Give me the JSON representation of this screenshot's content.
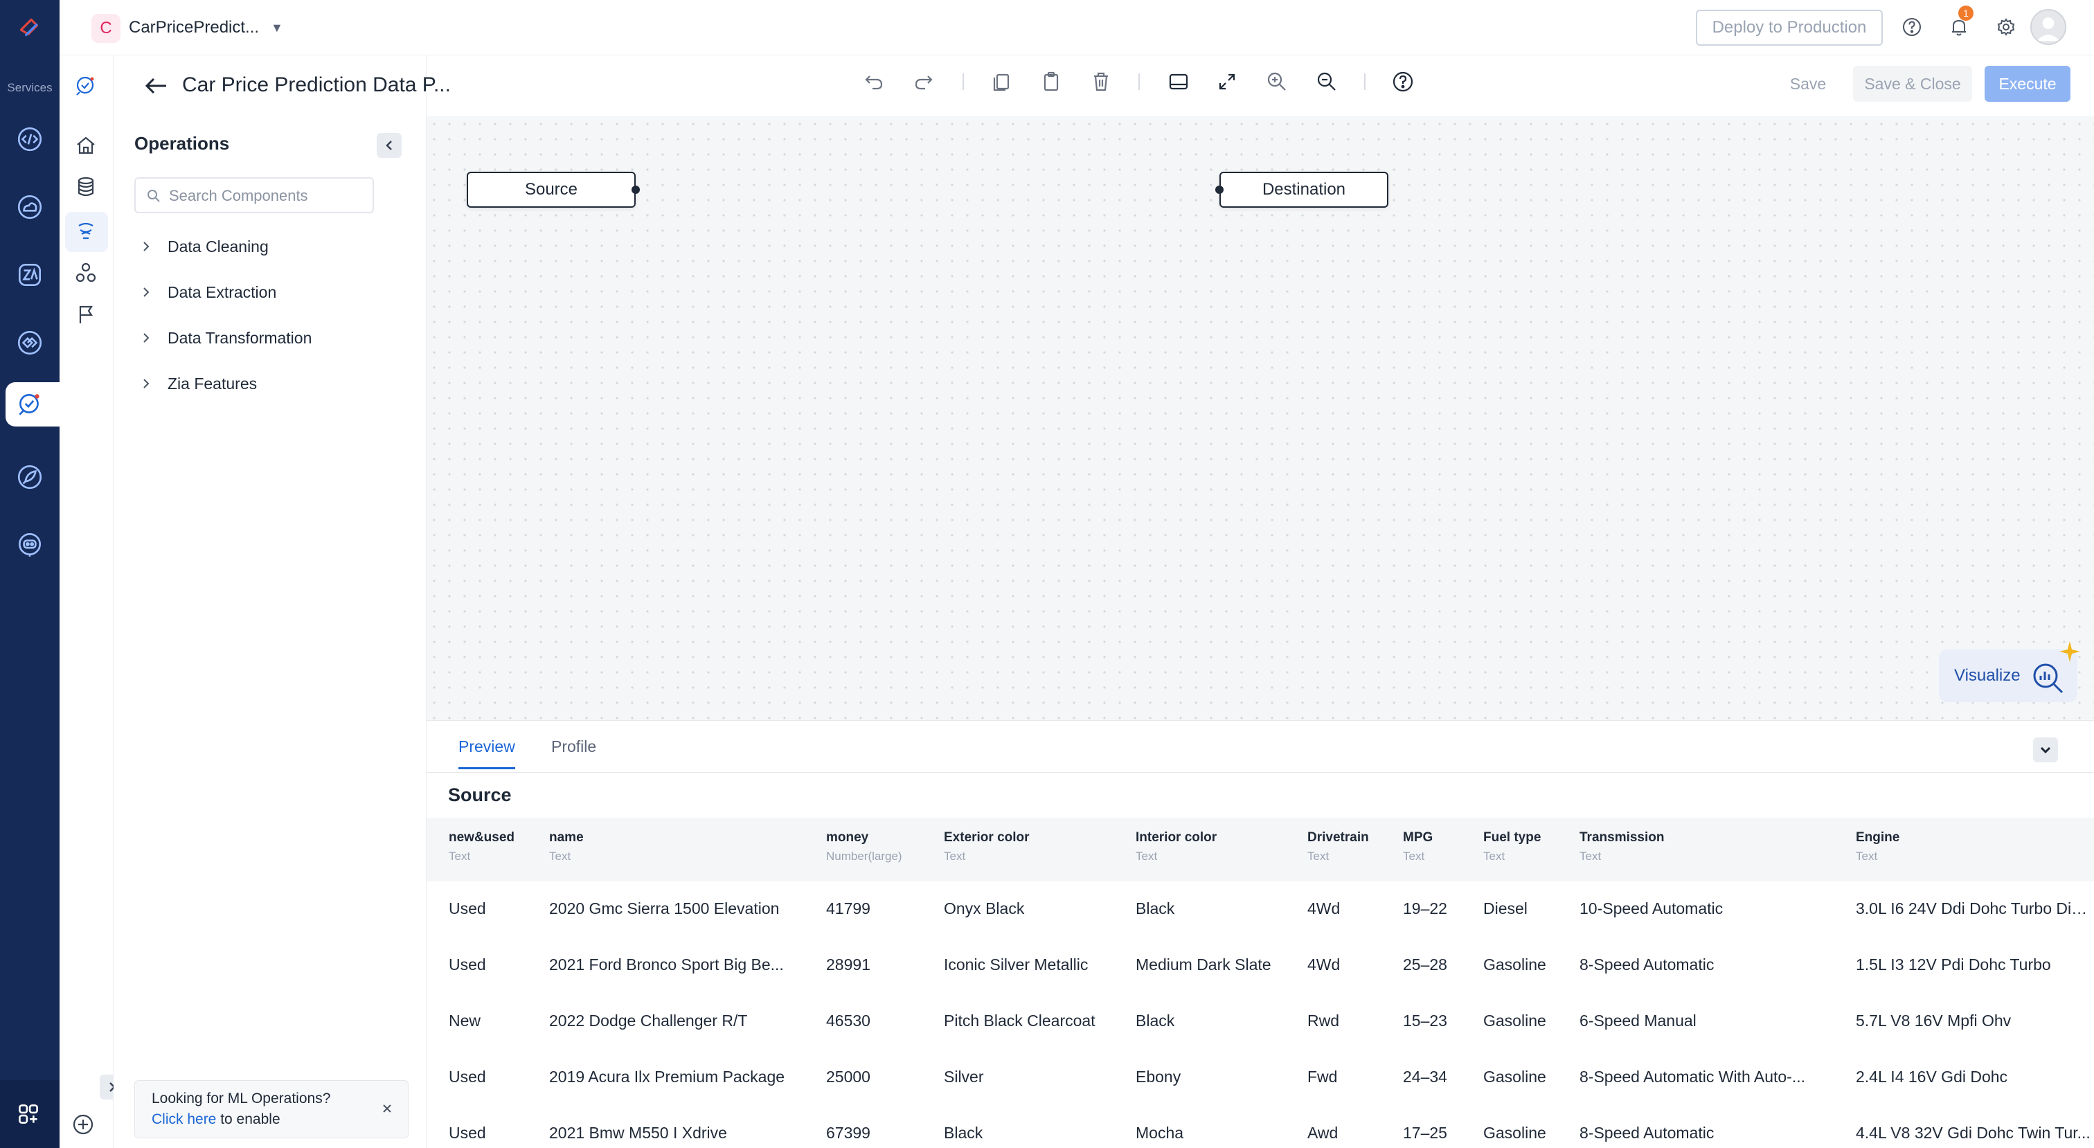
{
  "rail": {
    "services_label": "Services"
  },
  "header": {
    "project_initial": "C",
    "project_name": "CarPricePredict...",
    "deploy_label": "Deploy to Production",
    "notification_count": "1"
  },
  "page": {
    "title": "Car Price Prediction Data P..."
  },
  "toolbar": {
    "save_label": "Save",
    "save_close_label": "Save & Close",
    "execute_label": "Execute"
  },
  "operations": {
    "title": "Operations",
    "search_placeholder": "Search Components",
    "items": [
      {
        "label": "Data Cleaning"
      },
      {
        "label": "Data Extraction"
      },
      {
        "label": "Data Transformation"
      },
      {
        "label": "Zia Features"
      }
    ],
    "mlops_prompt": "Looking for ML Operations?",
    "mlops_link": "Click here",
    "mlops_suffix": " to enable"
  },
  "canvas": {
    "nodes": [
      {
        "label": "Source"
      },
      {
        "label": "Destination"
      }
    ],
    "visualize_label": "Visualize"
  },
  "preview": {
    "tabs": [
      {
        "label": "Preview",
        "active": true
      },
      {
        "label": "Profile",
        "active": false
      }
    ],
    "section_title": "Source",
    "columns": [
      {
        "name": "new&used",
        "type": "Text"
      },
      {
        "name": "name",
        "type": "Text"
      },
      {
        "name": "money",
        "type": "Number(large)"
      },
      {
        "name": "Exterior color",
        "type": "Text"
      },
      {
        "name": "Interior color",
        "type": "Text"
      },
      {
        "name": "Drivetrain",
        "type": "Text"
      },
      {
        "name": "MPG",
        "type": "Text"
      },
      {
        "name": "Fuel type",
        "type": "Text"
      },
      {
        "name": "Transmission",
        "type": "Text"
      },
      {
        "name": "Engine",
        "type": "Text"
      }
    ],
    "rows": [
      [
        "Used",
        "2020 Gmc Sierra 1500 Elevation",
        "41799",
        "Onyx Black",
        "Black",
        "4Wd",
        "19–22",
        "Diesel",
        "10-Speed Automatic",
        "3.0L I6 24V Ddi Dohc Turbo Die..."
      ],
      [
        "Used",
        "2021 Ford Bronco Sport Big Be...",
        "28991",
        "Iconic Silver Metallic",
        "Medium Dark Slate",
        "4Wd",
        "25–28",
        "Gasoline",
        "8-Speed Automatic",
        "1.5L I3 12V Pdi Dohc Turbo"
      ],
      [
        "New",
        "2022 Dodge Challenger R/T",
        "46530",
        "Pitch Black Clearcoat",
        "Black",
        "Rwd",
        "15–23",
        "Gasoline",
        "6-Speed Manual",
        "5.7L V8 16V Mpfi Ohv"
      ],
      [
        "Used",
        "2019 Acura Ilx Premium Package",
        "25000",
        "Silver",
        "Ebony",
        "Fwd",
        "24–34",
        "Gasoline",
        "8-Speed Automatic With Auto-...",
        "2.4L I4 16V Gdi Dohc"
      ],
      [
        "Used",
        "2021 Bmw M550 I Xdrive",
        "67399",
        "Black",
        "Mocha",
        "Awd",
        "17–25",
        "Gasoline",
        "8-Speed Automatic",
        "4.4L V8 32V Gdi Dohc Twin Tur..."
      ]
    ]
  }
}
